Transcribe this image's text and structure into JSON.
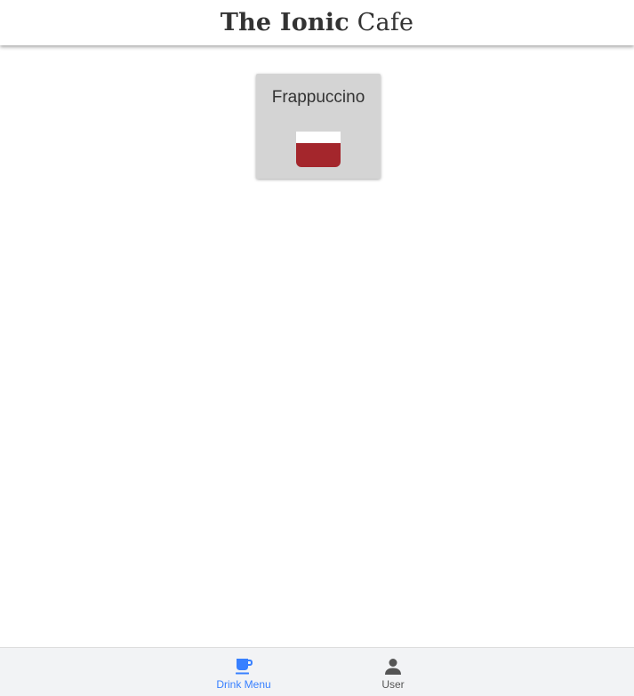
{
  "header": {
    "title_bold": "The Ionic",
    "title_light": "Cafe"
  },
  "drinks": [
    {
      "name": "Frappuccino",
      "icon": "cup-icon",
      "cup_colors": {
        "top": "#ffffff",
        "body": "#a4262c"
      }
    }
  ],
  "tabs": [
    {
      "label": "Drink Menu",
      "icon": "coffee-cup-icon",
      "active": true,
      "color": "#3880ff"
    },
    {
      "label": "User",
      "icon": "person-icon",
      "active": false,
      "color": "#555555"
    }
  ],
  "colors": {
    "active_tab": "#3880ff",
    "inactive_tab": "#555555",
    "card_bg": "#d4d4d4",
    "tabbar_bg": "#f2f3f5"
  }
}
